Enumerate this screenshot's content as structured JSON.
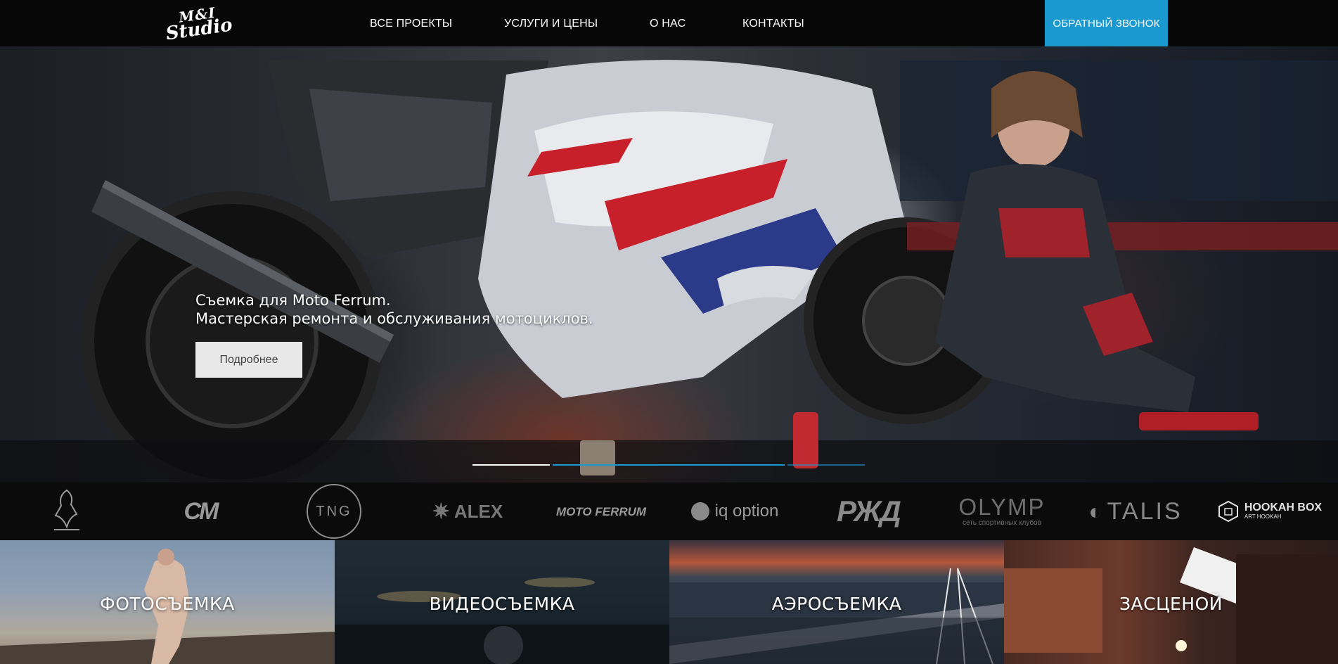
{
  "header": {
    "logo": {
      "line1": "M&I",
      "line2": "Studio"
    },
    "nav": [
      {
        "label": "ВСЕ ПРОЕКТЫ"
      },
      {
        "label": "УСЛУГИ И ЦЕНЫ"
      },
      {
        "label": "О НАС"
      },
      {
        "label": "КОНТАКТЫ"
      }
    ],
    "cta_label": "ОБРАТНЫЙ ЗВОНОК"
  },
  "hero": {
    "title_line1": "Съемка для Moto Ferrum.",
    "title_line2": "Мастерская ремонта и обслуживания мотоциклов.",
    "button_label": "Подробнее",
    "slides": [
      {
        "state": "viewed"
      },
      {
        "state": "active"
      },
      {
        "state": "upcoming"
      }
    ],
    "colors": {
      "viewed": "#ffffff",
      "active": "#1a98d0",
      "upcoming": "#1a98d0"
    }
  },
  "clients": [
    {
      "name": "equestrian-club-logo",
      "text": ""
    },
    {
      "name": "cm-logo",
      "text": "CM"
    },
    {
      "name": "tng-logo",
      "text": "TNG"
    },
    {
      "name": "alex-fitness-logo",
      "text": "ALEX"
    },
    {
      "name": "moto-ferrum-logo",
      "text": "MOTO FERRUM"
    },
    {
      "name": "iq-option-logo",
      "text": "iq option"
    },
    {
      "name": "rzd-logo",
      "text": "РЖД"
    },
    {
      "name": "olymp-logo",
      "text": "OLYMP",
      "sub": "сеть спортивных клубов"
    },
    {
      "name": "talis-logo",
      "text": "TALIS"
    },
    {
      "name": "hookah-box-logo",
      "text": "HOOKAH BOX",
      "sub": "ART HOOKAH"
    }
  ],
  "categories": [
    {
      "label": "ФОТОСЪЕМКА"
    },
    {
      "label": "ВИДЕОСЪЕМКА"
    },
    {
      "label": "АЭРОСЪЕМКА"
    },
    {
      "label": "ЗАСЦЕНОЙ"
    }
  ],
  "colors": {
    "accent": "#1a98d0",
    "header_bg": "#070707"
  }
}
